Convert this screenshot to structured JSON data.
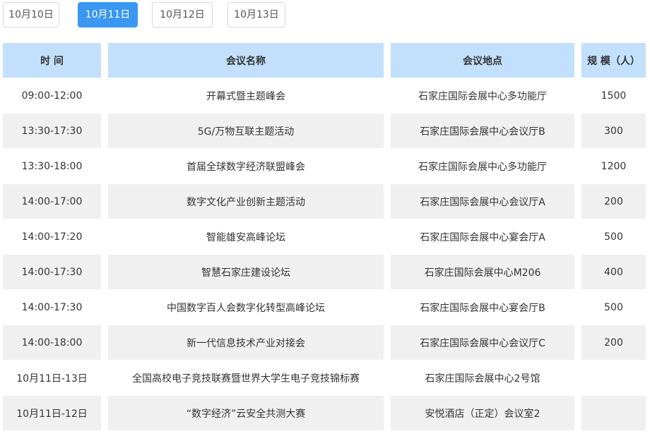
{
  "date_tabs": [
    {
      "label": "10月10日",
      "active": false
    },
    {
      "label": "10月11日",
      "active": true
    },
    {
      "label": "10月12日",
      "active": false
    },
    {
      "label": "10月13日",
      "active": false
    }
  ],
  "table": {
    "headers": [
      "时 间",
      "会议名称",
      "会议地点",
      "规 模（人）"
    ],
    "rows": [
      [
        "09:00-12:00",
        "开幕式暨主题峰会",
        "石家庄国际会展中心多功能厅",
        "1500"
      ],
      [
        "13:30-17:30",
        "5G/万物互联主题活动",
        "石家庄国际会展中心会议厅B",
        "300"
      ],
      [
        "13:30-18:00",
        "首届全球数字经济联盟峰会",
        "石家庄国际会展中心多功能厅",
        "1200"
      ],
      [
        "14:00-17:00",
        "数字文化产业创新主题活动",
        "石家庄国际会展中心会议厅A",
        "200"
      ],
      [
        "14:00-17:20",
        "智能雄安高峰论坛",
        "石家庄国际会展中心宴会厅A",
        "500"
      ],
      [
        "14:00-17:30",
        "智慧石家庄建设论坛",
        "石家庄国际会展中心M206",
        "400"
      ],
      [
        "14:00-17:30",
        "中国数字百人会数字化转型高峰论坛",
        "石家庄国际会展中心宴会厅B",
        "500"
      ],
      [
        "14:00-18:00",
        "新一代信息技术产业对接会",
        "石家庄国际会展中心会议厅C",
        "200"
      ],
      [
        "10月11日-13日",
        "全国高校电子竞技联赛暨世界大学生电子竞技锦标赛",
        "石家庄国际会展中心2号馆",
        ""
      ],
      [
        "10月11日-12日",
        "“数字经济”云安全共测大赛",
        "安悦酒店（正定）会议室2",
        ""
      ]
    ]
  },
  "colors": {
    "accent": "#3a97f2",
    "header_bg": "#c2e0fb",
    "stripe_bg": "#f0f0f1"
  }
}
